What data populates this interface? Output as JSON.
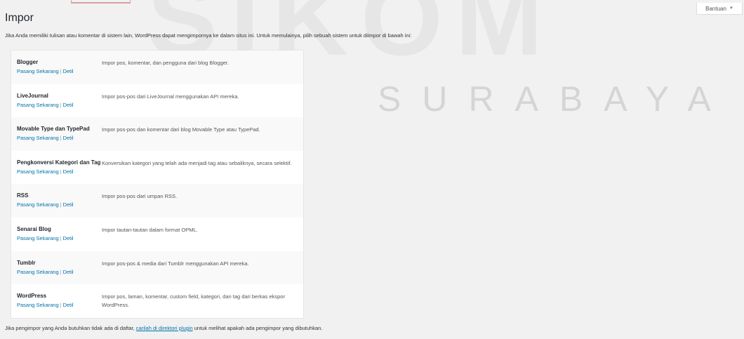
{
  "help_tab": {
    "label": "Bantuan",
    "caret": "▼"
  },
  "page_title": "Impor",
  "intro_text": "Jika Anda memiliki tulisan atau komentar di sistem lain, WordPress dapat mengimpornya ke dalam situs ini. Untuk memulainya, pilih sebuah sistem untuk diimpor di bawah ini:",
  "watermark": {
    "big": "SIKOM",
    "sub": "SURABAYA"
  },
  "importers": [
    {
      "name": "Blogger",
      "install": "Pasang Sekarang",
      "separator": "|",
      "details": "Detil",
      "description": "Impor pos, komentar, dan pengguna dari blog Blogger."
    },
    {
      "name": "LiveJournal",
      "install": "Pasang Sekarang",
      "separator": "|",
      "details": "Detil",
      "description": "Impor pos-pos dari LiveJournal menggunakan API mereka."
    },
    {
      "name": "Movable Type dan TypePad",
      "install": "Pasang Sekarang",
      "separator": "|",
      "details": "Detil",
      "description": "Impor pos-pos dan komentar dari blog Movable Type atau TypePad."
    },
    {
      "name": "Pengkonversi Kategori dan Tag",
      "install": "Pasang Sekarang",
      "separator": "|",
      "details": "Detil",
      "description": "Konversikan kategori yang telah ada menjadi tag atau sebaliknya, secara selektif."
    },
    {
      "name": "RSS",
      "install": "Pasang Sekarang",
      "separator": "|",
      "details": "Detil",
      "description": "Impor pos-pos dari umpan RSS."
    },
    {
      "name": "Senarai Blog",
      "install": "Pasang Sekarang",
      "separator": "|",
      "details": "Detil",
      "description": "Impor tautan-tautan dalam format OPML."
    },
    {
      "name": "Tumblr",
      "install": "Pasang Sekarang",
      "separator": "|",
      "details": "Detil",
      "description": "Impor pos-pos & media dari Tumblr menggunakan API mereka."
    },
    {
      "name": "WordPress",
      "install": "Pasang Sekarang",
      "separator": "|",
      "details": "Detil",
      "description": "Impor pos, laman, komentar, custom field, kategori, dan tag dari berkas ekspor WordPress."
    }
  ],
  "footer": {
    "before": "Jika pengimpor yang Anda butuhkan tidak ada di daftar, ",
    "link": "carilah di direktori plugin",
    "after": " untuk melihat apakah ada pengimpor yang dibutuhkan."
  }
}
